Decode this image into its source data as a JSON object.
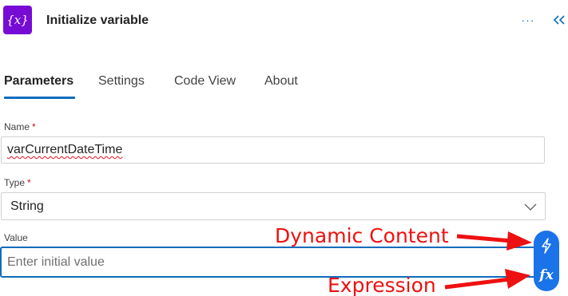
{
  "header": {
    "icon_glyph": "{x}",
    "title": "Initialize variable",
    "more_label": "···",
    "icons": {
      "action": "variable-icon",
      "more": "more-icon",
      "collapse": "collapse-icon"
    }
  },
  "tabs": [
    {
      "label": "Parameters",
      "active": true
    },
    {
      "label": "Settings",
      "active": false
    },
    {
      "label": "Code View",
      "active": false
    },
    {
      "label": "About",
      "active": false
    }
  ],
  "fields": {
    "name": {
      "label": "Name",
      "required_mark": "*",
      "value": "varCurrentDateTime"
    },
    "type": {
      "label": "Type",
      "required_mark": "*",
      "value": "String"
    },
    "value": {
      "label": "Value",
      "placeholder": "Enter initial value"
    }
  },
  "token_buttons": {
    "dynamic_icon": "lightning-icon",
    "expression_label": "fx"
  },
  "annotations": {
    "dynamic": "Dynamic Content",
    "expression": "Expression"
  },
  "colors": {
    "accent": "#0f6cbd",
    "action_icon_bg": "#770bd6",
    "token_button_bg": "#1a73e8",
    "required": "#c50f1f",
    "annotation": "#ee1111"
  }
}
